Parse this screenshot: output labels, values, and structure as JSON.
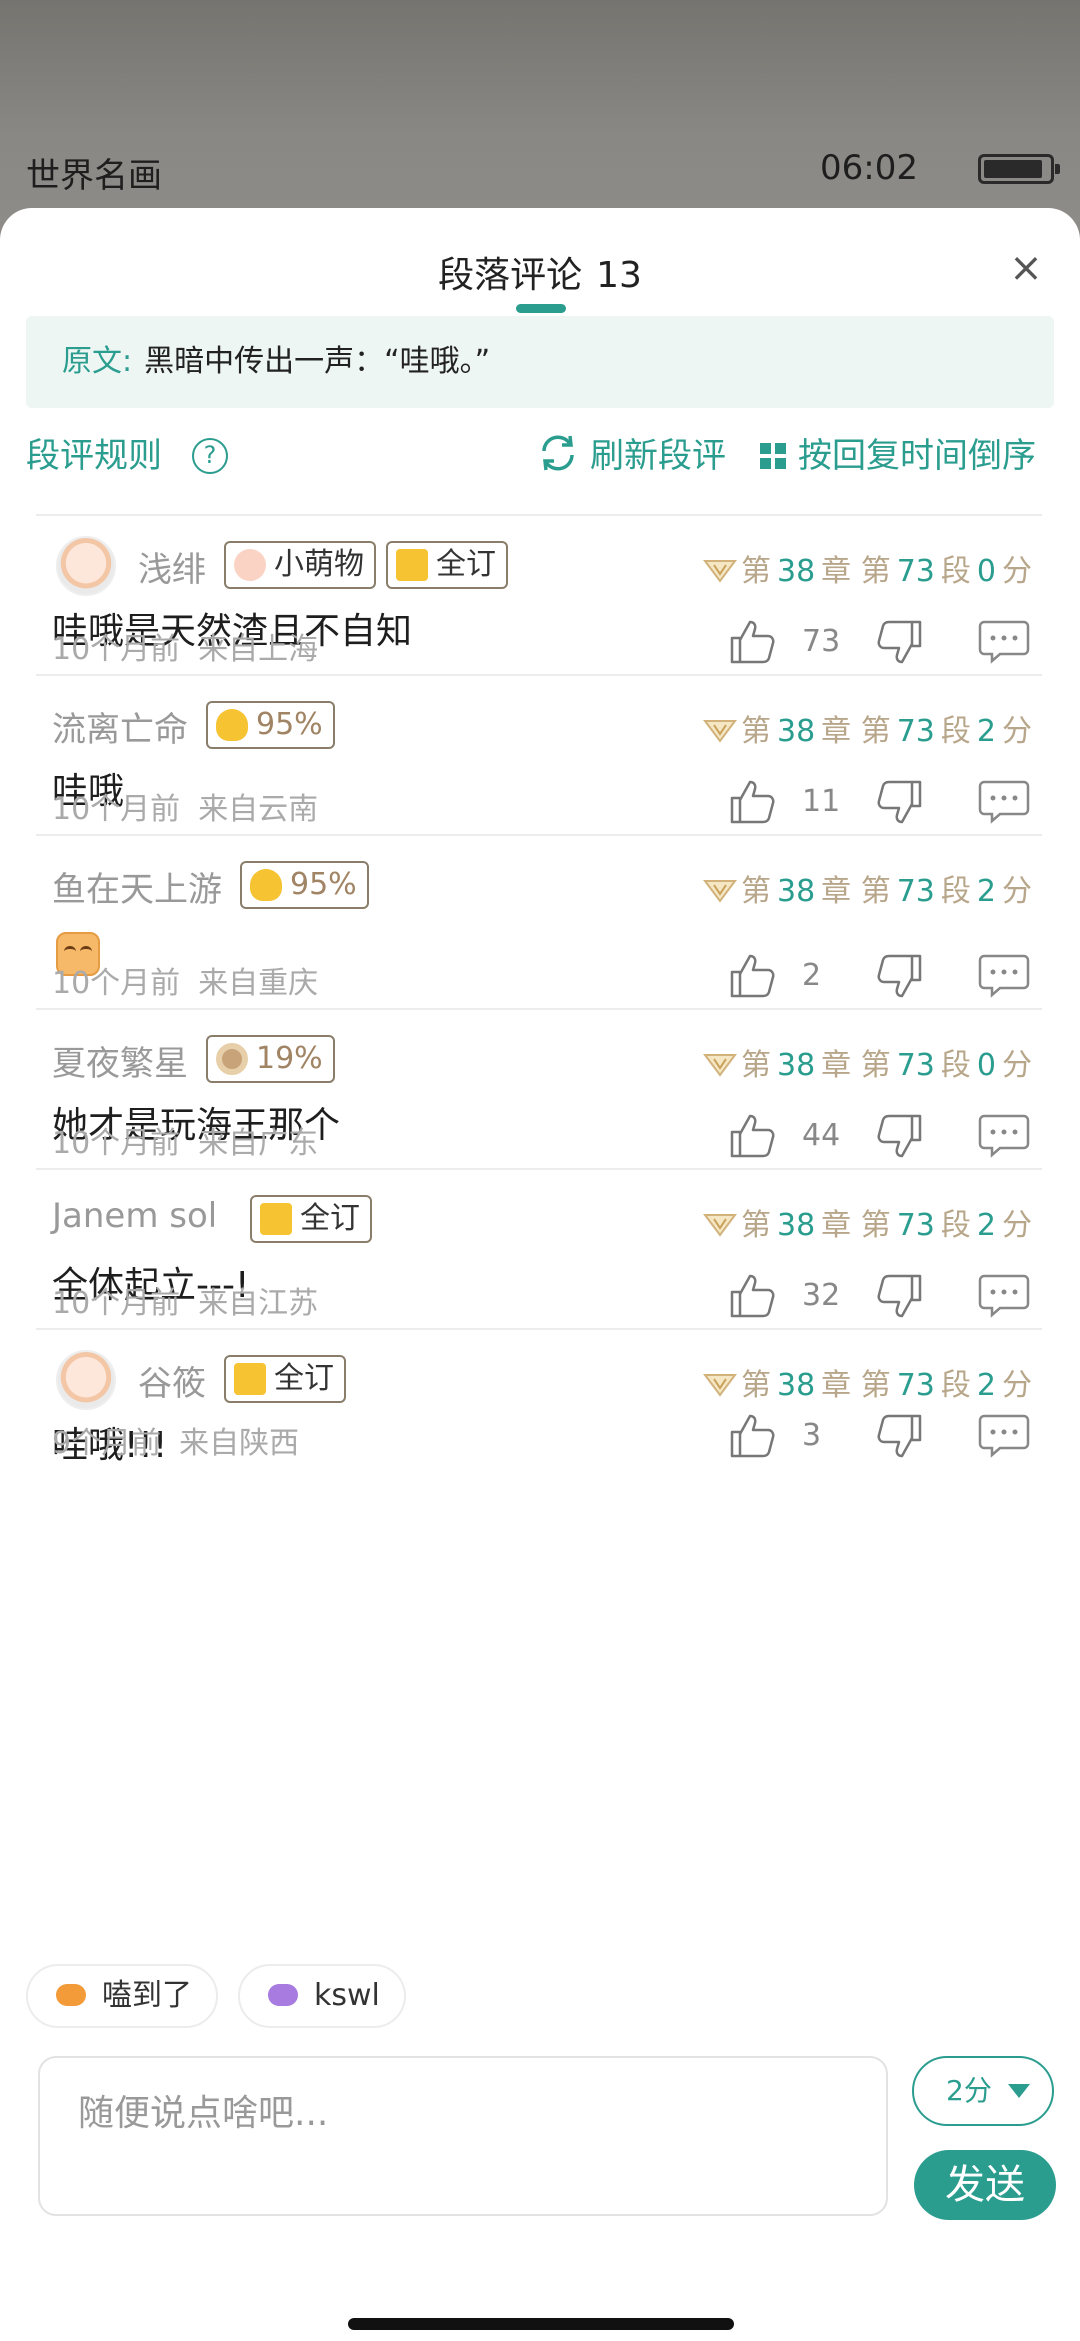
{
  "status_bar": {
    "book_title": "世界名画",
    "time": "06:02"
  },
  "panel": {
    "title": "段落评论",
    "count": "13",
    "close_icon": "×",
    "source_label": "原文:",
    "source_text": "黑暗中传出一声：“哇哦。”"
  },
  "toolbar": {
    "rules": "段评规则",
    "help": "?",
    "refresh": "刷新段评",
    "sort": "按回复时间倒序"
  },
  "chapter_labels": {
    "chapter_prefix": "第",
    "chapter_suffix": "章",
    "para_prefix": "第",
    "para_suffix": "段",
    "score_suffix": "分"
  },
  "comments": [
    {
      "user": "浅绯",
      "has_avatar": true,
      "badges": [
        {
          "type": "paw",
          "text": "小萌物"
        },
        {
          "type": "sub",
          "text": "全订"
        }
      ],
      "chapter": "38",
      "paragraph": "73",
      "score": "0",
      "text": "哇哦是天然渣且不自知",
      "time": "10个月前",
      "location": "来自上海",
      "likes": "73"
    },
    {
      "user": "流离亡命",
      "has_avatar": false,
      "badges": [
        {
          "type": "gold",
          "text": "95%"
        }
      ],
      "chapter": "38",
      "paragraph": "73",
      "score": "2",
      "text": "哇哦",
      "time": "10个月前",
      "location": "来自云南",
      "likes": "11"
    },
    {
      "user": "鱼在天上游",
      "has_avatar": false,
      "badges": [
        {
          "type": "gold",
          "text": "95%"
        }
      ],
      "chapter": "38",
      "paragraph": "73",
      "score": "2",
      "text": "",
      "emoji": "smile-emoji",
      "time": "10个月前",
      "location": "来自重庆",
      "likes": "2"
    },
    {
      "user": "夏夜繁星",
      "has_avatar": false,
      "badges": [
        {
          "type": "coin",
          "text": "19%"
        }
      ],
      "chapter": "38",
      "paragraph": "73",
      "score": "0",
      "text": "她才是玩海王那个",
      "time": "10个月前",
      "location": "来自广东",
      "likes": "44"
    },
    {
      "user": "Janem sol",
      "has_avatar": false,
      "badges": [
        {
          "type": "sub",
          "text": "全订"
        }
      ],
      "chapter": "38",
      "paragraph": "73",
      "score": "2",
      "text": "全体起立---!",
      "time": "10个月前",
      "location": "来自江苏",
      "likes": "32"
    },
    {
      "user": "谷筱",
      "has_avatar": true,
      "badges": [
        {
          "type": "sub",
          "text": "全订"
        }
      ],
      "chapter": "38",
      "paragraph": "73",
      "score": "2",
      "text": "哇哦!!!",
      "time": "9个月前",
      "location": "来自陕西",
      "likes": "3"
    }
  ],
  "quick_replies": [
    {
      "text": "嗑到了",
      "icon": "candy-icon",
      "color": "#f29b38"
    },
    {
      "text": "kswl",
      "icon": "candy-icon",
      "color": "#a77be0"
    }
  ],
  "composer": {
    "placeholder": "随便说点啥吧...",
    "score_label": "2分",
    "send_label": "发送"
  },
  "colors": {
    "accent": "#2a9d8f",
    "source_bg": "#eef6f4"
  }
}
